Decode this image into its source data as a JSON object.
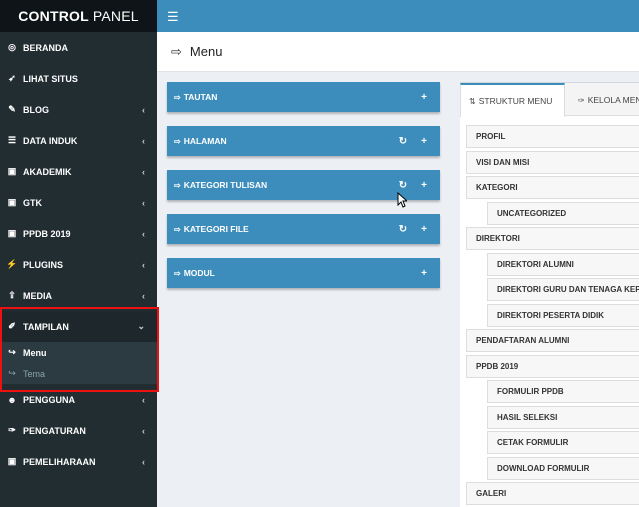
{
  "brand": {
    "bold": "CONTROL",
    "rest": "PANEL"
  },
  "sidebar": {
    "items": [
      {
        "label": "BERANDA",
        "icon": "dashboard-icon",
        "glyph": "◎",
        "chevron": false
      },
      {
        "label": "LIHAT SITUS",
        "icon": "rocket-icon",
        "glyph": "➶",
        "chevron": false
      },
      {
        "label": "BLOG",
        "icon": "edit-icon",
        "glyph": "✎",
        "chevron": true
      },
      {
        "label": "DATA INDUK",
        "icon": "list-icon",
        "glyph": "☰",
        "chevron": true
      },
      {
        "label": "AKADEMIK",
        "icon": "book-icon",
        "glyph": "▣",
        "chevron": true
      },
      {
        "label": "GTK",
        "icon": "book-icon",
        "glyph": "▣",
        "chevron": true
      },
      {
        "label": "PPDB 2019",
        "icon": "book-icon",
        "glyph": "▣",
        "chevron": true
      },
      {
        "label": "PLUGINS",
        "icon": "plug-icon",
        "glyph": "⚡",
        "chevron": true
      },
      {
        "label": "MEDIA",
        "icon": "upload-icon",
        "glyph": "⇪",
        "chevron": true
      },
      {
        "label": "TAMPILAN",
        "icon": "paint-brush-icon",
        "glyph": "✐",
        "chevron": true,
        "open": true
      }
    ],
    "submenu": [
      {
        "label": "Menu",
        "active": true,
        "glyph": "↪"
      },
      {
        "label": "Tema",
        "active": false,
        "glyph": "↪"
      }
    ],
    "items_after": [
      {
        "label": "PENGGUNA",
        "icon": "users-icon",
        "glyph": "☻",
        "chevron": true
      },
      {
        "label": "PENGATURAN",
        "icon": "wrench-icon",
        "glyph": "✑",
        "chevron": true
      },
      {
        "label": "PEMELIHARAAN",
        "icon": "camera-icon",
        "glyph": "▣",
        "chevron": true
      }
    ]
  },
  "header": {
    "title": "Menu",
    "icon": "sign-in-icon"
  },
  "panels": [
    {
      "label": "TAUTAN",
      "refresh": false
    },
    {
      "label": "HALAMAN",
      "refresh": true
    },
    {
      "label": "KATEGORI TULISAN",
      "refresh": true
    },
    {
      "label": "KATEGORI FILE",
      "refresh": true
    },
    {
      "label": "MODUL",
      "refresh": false
    }
  ],
  "tabs": {
    "active": "STRUKTUR MENU",
    "second": "KELOLA MENU"
  },
  "tree": [
    {
      "label": "PROFIL",
      "child": false
    },
    {
      "label": "VISI DAN MISI",
      "child": false
    },
    {
      "label": "KATEGORI",
      "child": false
    },
    {
      "label": "UNCATEGORIZED",
      "child": true
    },
    {
      "label": "DIREKTORI",
      "child": false
    },
    {
      "label": "DIREKTORI ALUMNI",
      "child": true
    },
    {
      "label": "DIREKTORI GURU DAN TENAGA KEPENDIDIKAN",
      "child": true
    },
    {
      "label": "DIREKTORI PESERTA DIDIK",
      "child": true
    },
    {
      "label": "PENDAFTARAN ALUMNI",
      "child": false
    },
    {
      "label": "PPDB 2019",
      "child": false
    },
    {
      "label": "FORMULIR PPDB",
      "child": true
    },
    {
      "label": "HASIL SELEKSI",
      "child": true
    },
    {
      "label": "CETAK FORMULIR",
      "child": true
    },
    {
      "label": "DOWNLOAD FORMULIR",
      "child": true
    },
    {
      "label": "GALERI",
      "child": false
    }
  ],
  "colors": {
    "primary": "#3c8dbc",
    "sidebar": "#222d32",
    "highlight": "#ee1111"
  }
}
